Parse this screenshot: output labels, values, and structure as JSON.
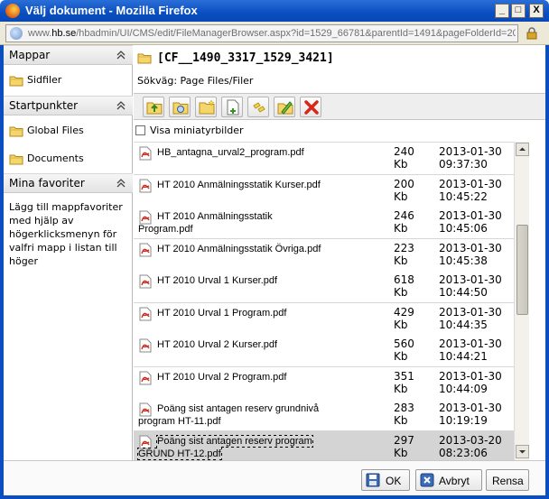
{
  "window": {
    "title": "Välj dokument - Mozilla Firefox",
    "min_label": "_",
    "max_label": "□",
    "close_label": "X"
  },
  "address": {
    "url_prefix": "www.",
    "url_domain": "hb.se",
    "url_rest": "/hbadmin/UI/CMS/edit/FileManagerBrowser.aspx?id=1529_66781&parentId=1491&pageFolderId=20"
  },
  "sidebar": {
    "sections": [
      {
        "label": "Mappar",
        "items": [
          {
            "label": "Sidfiler"
          }
        ]
      },
      {
        "label": "Startpunkter",
        "items": [
          {
            "label": "Global Files"
          },
          {
            "label": "Documents"
          }
        ]
      },
      {
        "label": "Mina favoriter",
        "help": "Lägg till mappfavoriter med hjälp av högerklicksmenyn för valfri mapp i listan till höger"
      }
    ]
  },
  "main": {
    "folder": "[CF__1490_3317_1529_3421]",
    "path": "Sökväg: Page Files/Filer",
    "thumbnails_label": "Visa miniatyrbilder",
    "toolbar_icons": [
      "folder-up-icon",
      "open-folder-icon",
      "new-folder-icon",
      "new-file-icon",
      "link-icon",
      "edit-icon",
      "delete-icon"
    ],
    "files": [
      {
        "name": "HB_antagna_urval2_program.pdf",
        "size": "240",
        "unit": "Kb",
        "date": "2013-01-30",
        "time": "09:37:30"
      },
      {
        "name": "HT 2010 Anmälningsstatik Kurser.pdf",
        "size": "200",
        "unit": "Kb",
        "date": "2013-01-30",
        "time": "10:45:22"
      },
      {
        "name": "HT 2010 Anmälningsstatik Program.pdf",
        "size": "246",
        "unit": "Kb",
        "date": "2013-01-30",
        "time": "10:45:06"
      },
      {
        "name": "HT 2010 Anmälningsstatik Övriga.pdf",
        "size": "223",
        "unit": "Kb",
        "date": "2013-01-30",
        "time": "10:45:38"
      },
      {
        "name": "HT 2010 Urval 1 Kurser.pdf",
        "size": "618",
        "unit": "Kb",
        "date": "2013-01-30",
        "time": "10:44:50"
      },
      {
        "name": "HT 2010 Urval 1 Program.pdf",
        "size": "429",
        "unit": "Kb",
        "date": "2013-01-30",
        "time": "10:44:35"
      },
      {
        "name": "HT 2010 Urval 2 Kurser.pdf",
        "size": "560",
        "unit": "Kb",
        "date": "2013-01-30",
        "time": "10:44:21"
      },
      {
        "name": "HT 2010 Urval 2 Program.pdf",
        "size": "351",
        "unit": "Kb",
        "date": "2013-01-30",
        "time": "10:44:09"
      },
      {
        "name": "Poäng sist antagen reserv grundnivå program HT-11.pdf",
        "size": "283",
        "unit": "Kb",
        "date": "2013-01-30",
        "time": "10:19:19"
      },
      {
        "name": "Poäng sist antagen reserv program GRUND HT-12.pdf",
        "size": "297",
        "unit": "Kb",
        "date": "2013-03-20",
        "time": "08:23:06",
        "selected": true
      }
    ]
  },
  "buttons": {
    "ok": "OK",
    "cancel": "Avbryt",
    "clear": "Rensa"
  }
}
